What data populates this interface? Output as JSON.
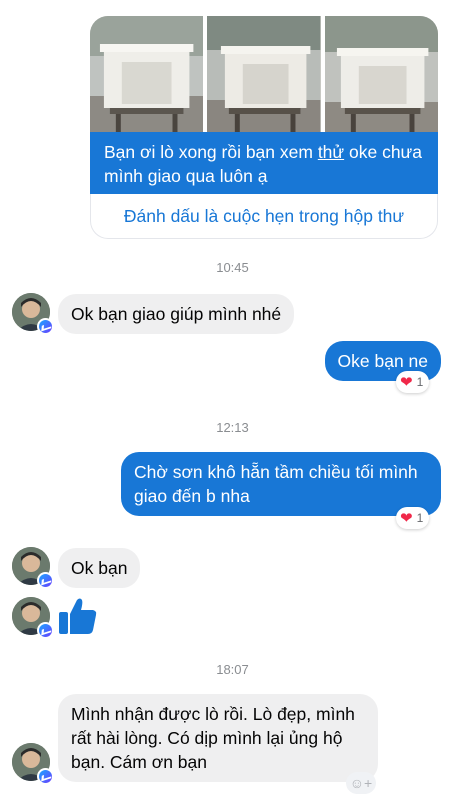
{
  "shared_post": {
    "photo_count": 3,
    "caption_part1": "Bạn ơi lò xong rồi bạn xem ",
    "caption_underlined": "thử",
    "caption_part2": " oke chưa mình giao qua luôn ạ",
    "action_link": "Đánh dấu là cuộc hẹn trong hộp thư"
  },
  "timestamps": [
    "10:45",
    "12:13",
    "18:07"
  ],
  "messages": [
    {
      "direction": "in",
      "text": "Ok bạn giao giúp mình nhé"
    },
    {
      "direction": "out",
      "text": "Oke bạn ne",
      "reaction": {
        "icon": "heart",
        "count": "1"
      }
    },
    {
      "direction": "out",
      "text": "Chờ sơn khô hẵn tầm chiều tối mình giao đến b nha",
      "reaction": {
        "icon": "heart",
        "count": "1"
      }
    },
    {
      "direction": "in",
      "text": "Ok bạn"
    },
    {
      "direction": "in",
      "type": "like",
      "icon": "thumbs-up-icon"
    },
    {
      "direction": "in",
      "text": "Mình nhận được lò rồi. Lò đẹp, mình rất hài lòng. Có dịp mình lại ủng hộ bạn. Cám ơn bạn"
    }
  ],
  "colors": {
    "outgoing_bubble": "#1877d6",
    "incoming_bubble": "#efeff0",
    "timestamp": "#8a8d91",
    "heart": "#f02849"
  }
}
